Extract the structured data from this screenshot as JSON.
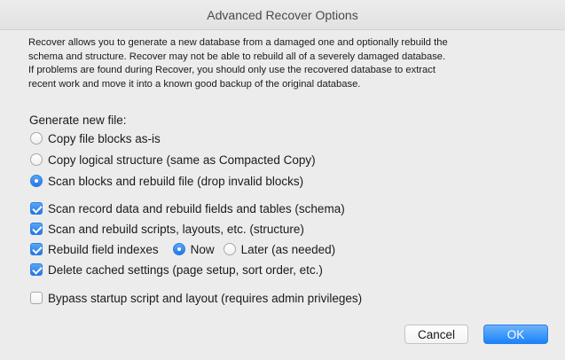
{
  "window": {
    "title": "Advanced Recover Options"
  },
  "description": {
    "lines": [
      "Recover allows you to generate a new database from a damaged one and optionally rebuild the",
      "schema and structure. Recover may not be able to rebuild all of a severely damaged database.",
      "If problems are found during Recover, you should only use the recovered database to extract",
      "recent work and move it into a known good backup of the original database."
    ]
  },
  "generate": {
    "label": "Generate new file:",
    "options": [
      {
        "label": "Copy file blocks as-is",
        "selected": false
      },
      {
        "label": "Copy logical structure (same as Compacted Copy)",
        "selected": false
      },
      {
        "label": "Scan blocks and rebuild file (drop invalid blocks)",
        "selected": true
      }
    ]
  },
  "checks": {
    "schema": {
      "label": "Scan record data and rebuild fields and tables (schema)",
      "checked": true
    },
    "structure": {
      "label": "Scan and rebuild scripts, layouts, etc. (structure)",
      "checked": true
    },
    "indexes": {
      "label": "Rebuild field indexes",
      "checked": true,
      "now_label": "Now",
      "now_selected": true,
      "later_label": "Later (as needed)",
      "later_selected": false
    },
    "cached": {
      "label": "Delete cached settings  (page setup, sort order, etc.)",
      "checked": true
    },
    "bypass": {
      "label": "Bypass startup script and layout (requires admin privileges)",
      "checked": false
    }
  },
  "buttons": {
    "cancel": "Cancel",
    "ok": "OK"
  },
  "colors": {
    "accent": "#2277e5",
    "background": "#ececec"
  }
}
